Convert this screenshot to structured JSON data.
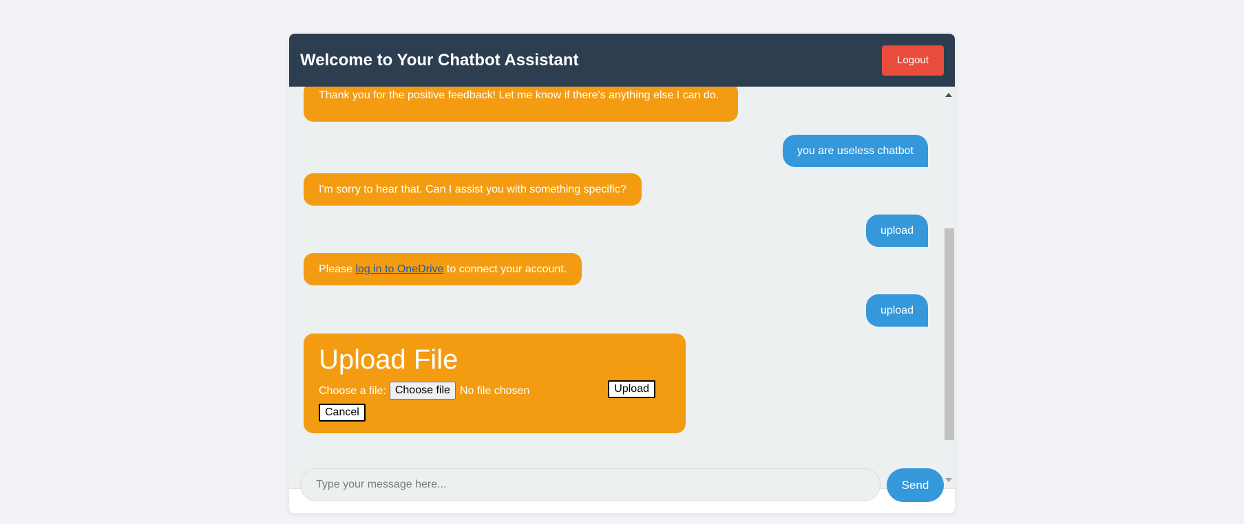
{
  "header": {
    "title": "Welcome to Your Chatbot Assistant",
    "logout_label": "Logout"
  },
  "messages": [
    {
      "role": "bot",
      "text": "Thank you for the positive feedback! Let me know if there's anything else I can do."
    },
    {
      "role": "user",
      "text": "you are useless chatbot"
    },
    {
      "role": "bot",
      "text": "I'm sorry to hear that. Can I assist you with something specific?"
    },
    {
      "role": "user",
      "text": "upload"
    },
    {
      "role": "bot",
      "text_before": "Please ",
      "link": "log in to OneDrive",
      "text_after": " to connect your account."
    },
    {
      "role": "user",
      "text": "upload"
    }
  ],
  "upload_card": {
    "title": "Upload File",
    "choose_label": "Choose a file:",
    "choose_button": "Choose file",
    "no_file": "No file chosen",
    "upload_button": "Upload",
    "cancel_button": "Cancel"
  },
  "composer": {
    "placeholder": "Type your message here...",
    "send_label": "Send"
  },
  "colors": {
    "header": "#2c3e50",
    "bot_bubble": "#f39c12",
    "user_bubble": "#3498db",
    "logout": "#e74c3c"
  }
}
